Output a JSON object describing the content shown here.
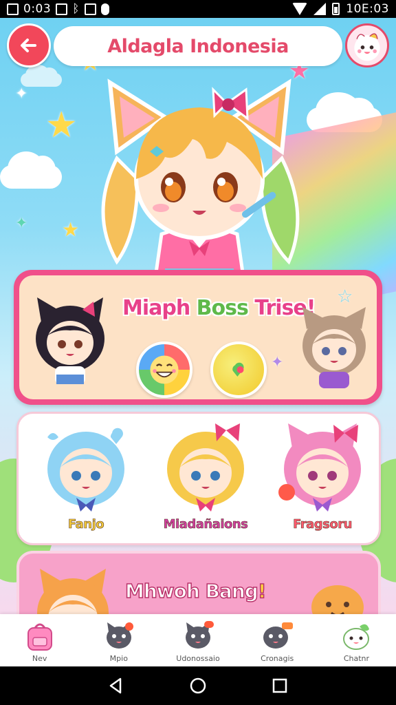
{
  "status_bar": {
    "clock": "0:03",
    "time": "10E:03",
    "icons": [
      "gallery-icon",
      "sim-icon",
      "bluetooth-icon",
      "sd-card-icon",
      "notification-pill-icon",
      "wifi-icon",
      "signal-icon",
      "battery-icon"
    ]
  },
  "header": {
    "title": "Aldagla Indonesia",
    "back_icon": "arrow-left-icon",
    "avatar_icon": "mascot-avatar-icon",
    "accent_color": "#f2475a"
  },
  "hero": {
    "icon": "cat-ear-girl-mascot"
  },
  "boss_card": {
    "title_part1": "Miaph ",
    "title_part2": "Boss",
    "title_part3": " Trise!",
    "left_character": "black-hair-cat-girl",
    "right_character": "brown-hair-cat-girl",
    "orbs": [
      "smiley-orb-icon",
      "heart-orb-icon"
    ],
    "border_color": "#f0508a"
  },
  "characters": [
    {
      "label": "Fanjo",
      "color": "#f2c93a",
      "hair": "#8fd3f4"
    },
    {
      "label": "Miadañaions",
      "color": "#d23fa0",
      "hair": "#f6c94a"
    },
    {
      "label": "Fragsoru",
      "color": "#ff5a6e",
      "hair": "#f28ac0"
    }
  ],
  "bang_card": {
    "title": "Mhwoh Bang",
    "title_mark": "!"
  },
  "bottom_nav": [
    {
      "label": "Nev",
      "icon": "backpack-icon"
    },
    {
      "label": "Mpio",
      "icon": "gray-cat-icon"
    },
    {
      "label": "Udonossaio",
      "icon": "gray-cat-badge-icon"
    },
    {
      "label": "Cronagis",
      "icon": "gray-cat-tag-icon"
    },
    {
      "label": "Chatnr",
      "icon": "white-bunny-icon"
    }
  ]
}
